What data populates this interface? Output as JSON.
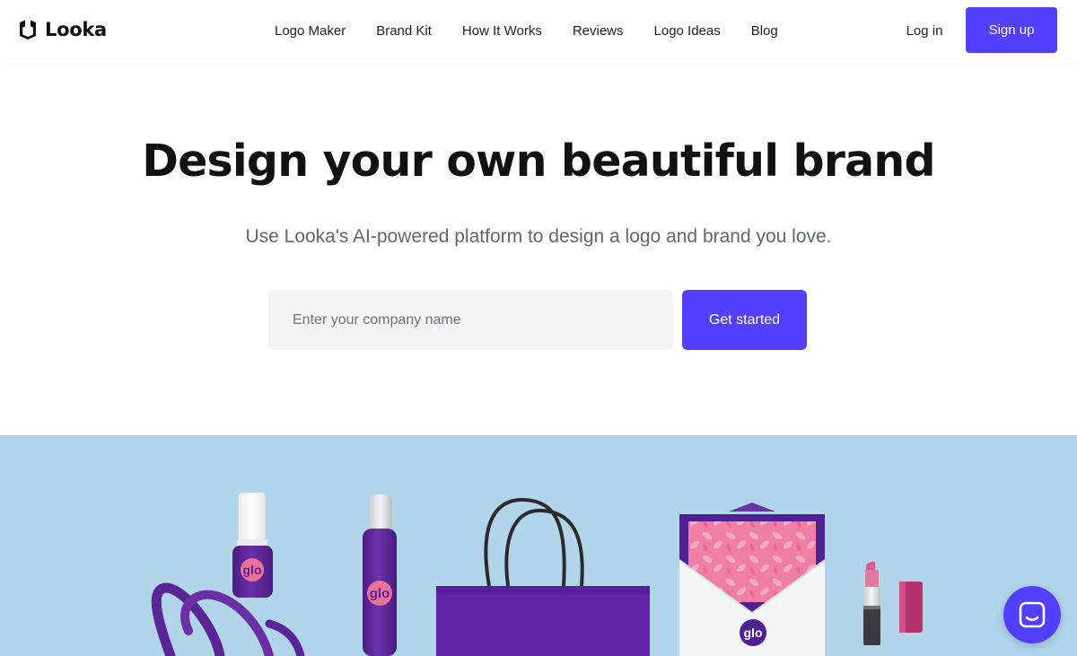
{
  "brand": {
    "name": "Looka",
    "icon": "looka-logo-icon"
  },
  "nav": {
    "items": [
      {
        "label": "Logo Maker"
      },
      {
        "label": "Brand Kit"
      },
      {
        "label": "How It Works"
      },
      {
        "label": "Reviews"
      },
      {
        "label": "Logo Ideas"
      },
      {
        "label": "Blog"
      }
    ],
    "login_label": "Log in",
    "signup_label": "Sign up"
  },
  "hero": {
    "title": "Design your own beautiful brand",
    "subtitle": "Use Looka's AI-powered platform to design a logo and brand you love.",
    "input_placeholder": "Enter your company name",
    "input_value": "",
    "cta_label": "Get started"
  },
  "showcase": {
    "logo_text": "glo",
    "items": [
      "ribbon",
      "nail-polish",
      "spray-bottle",
      "shopping-bag",
      "envelope",
      "lipstick",
      "lipstick-cap"
    ]
  },
  "chat": {
    "icon": "chat-smile-icon"
  },
  "colors": {
    "accent": "#5340ff",
    "showcase_background": "#b2d5ea",
    "product_purple": "#5a2594",
    "product_pink": "#e8739a",
    "heading_text": "#111111",
    "subtitle_text": "#5f6670",
    "input_background": "#f3f4f6"
  }
}
